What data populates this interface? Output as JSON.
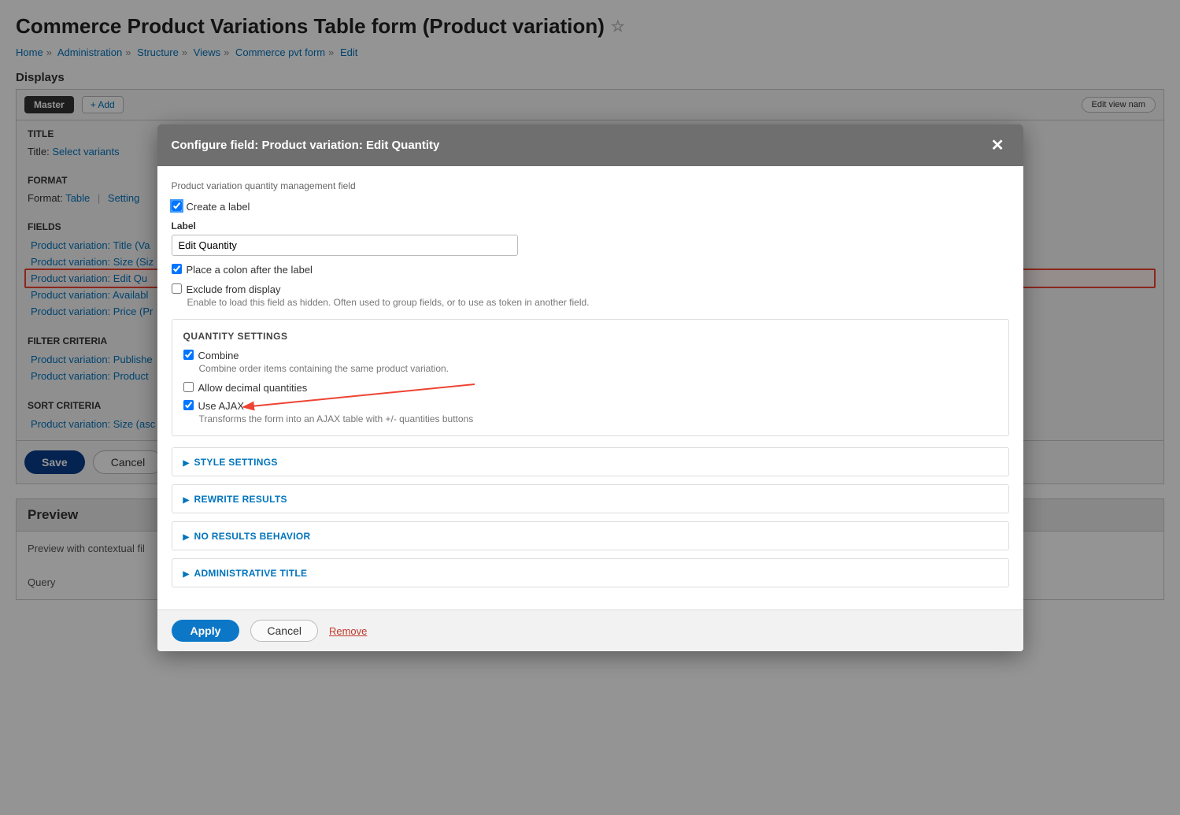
{
  "page_title": "Commerce Product Variations Table form (Product variation)",
  "breadcrumbs": [
    "Home",
    "Administration",
    "Structure",
    "Views",
    "Commerce pvt form",
    "Edit"
  ],
  "displays_label": "Displays",
  "tab_master": "Master",
  "add_btn": "+ Add",
  "edit_view_name": "Edit view nam",
  "buckets": {
    "title": {
      "header": "TITLE",
      "label": "Title:",
      "value": "Select variants"
    },
    "format": {
      "header": "FORMAT",
      "label": "Format:",
      "value": "Table",
      "settings": "Setting"
    },
    "fields": {
      "header": "FIELDS",
      "items": [
        "Product variation: Title (Va",
        "Product variation: Size (Siz",
        "Product variation: Edit Qu",
        "Product variation: Availabl",
        "Product variation: Price (Pr"
      ],
      "highlighted_index": 2
    },
    "filters": {
      "header": "FILTER CRITERIA",
      "items": [
        "Product variation: Publishe",
        "Product variation: Product"
      ]
    },
    "sort": {
      "header": "SORT CRITERIA",
      "items": [
        "Product variation: Size (asc"
      ]
    }
  },
  "actions": {
    "save": "Save",
    "cancel": "Cancel"
  },
  "preview": {
    "header": "Preview",
    "body": "Preview with contextual fil",
    "query": "Query"
  },
  "modal": {
    "title": "Configure field: Product variation: Edit Quantity",
    "desc": "Product variation quantity management field",
    "create_label": "Create a label",
    "label_field": "Label",
    "label_value": "Edit Quantity",
    "place_colon": "Place a colon after the label",
    "exclude": "Exclude from display",
    "exclude_help": "Enable to load this field as hidden. Often used to group fields, or to use as token in another field.",
    "qs_legend": "QUANTITY SETTINGS",
    "combine": "Combine",
    "combine_help": "Combine order items containing the same product variation.",
    "decimal": "Allow decimal quantities",
    "ajax": "Use AJAX",
    "ajax_help": "Transforms the form into an AJAX table with +/- quantities buttons",
    "details": [
      "STYLE SETTINGS",
      "REWRITE RESULTS",
      "NO RESULTS BEHAVIOR",
      "ADMINISTRATIVE TITLE"
    ],
    "apply": "Apply",
    "cancel": "Cancel",
    "remove": "Remove"
  }
}
